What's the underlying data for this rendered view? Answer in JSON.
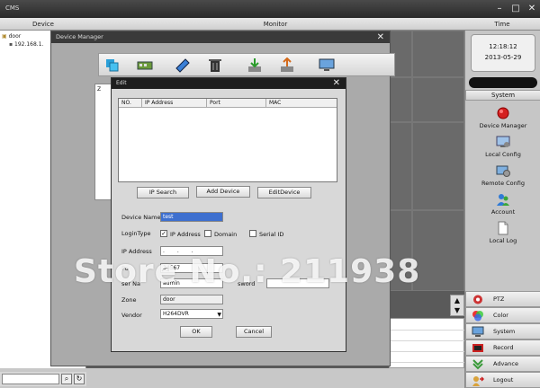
{
  "window": {
    "title": "CMS"
  },
  "columns": {
    "device": "Device",
    "monitor": "Monitor",
    "time": "Time"
  },
  "tree": {
    "root": "door",
    "child": "192.168.1."
  },
  "clock": {
    "time": "12:18:12",
    "date": "2013-05-29"
  },
  "system": {
    "header": "System",
    "items": [
      {
        "label": "Device Manager",
        "icon": "record-red-icon"
      },
      {
        "label": "Local Config",
        "icon": "local-config-icon"
      },
      {
        "label": "Remote Config",
        "icon": "remote-config-icon"
      },
      {
        "label": "Account",
        "icon": "account-icon"
      },
      {
        "label": "Local Log",
        "icon": "log-file-icon"
      }
    ]
  },
  "nav": [
    {
      "label": "PTZ",
      "icon": "ptz-icon"
    },
    {
      "label": "Color",
      "icon": "color-icon"
    },
    {
      "label": "System",
      "icon": "system-icon"
    },
    {
      "label": "Record",
      "icon": "record-icon"
    },
    {
      "label": "Advance",
      "icon": "advance-icon"
    },
    {
      "label": "Logout",
      "icon": "logout-icon"
    }
  ],
  "device_manager": {
    "title": "Device Manager",
    "list_preview": "Z"
  },
  "edit": {
    "title": "Edit",
    "table_headers": [
      "NO.",
      "IP Address",
      "Port",
      "MAC"
    ],
    "buttons": {
      "ip_search": "IP Search",
      "add_device": "Add Device",
      "edit_device": "EditDevice"
    },
    "labels": {
      "device_name": "Device Name",
      "login_type": "LoginType",
      "ip_address": "IP Address",
      "port": "Po",
      "user_name": "ser Na",
      "password": "sword",
      "zone": "Zone",
      "vendor": "Vendor"
    },
    "values": {
      "device_name": "test",
      "ip_address": ". . .",
      "port": "34567",
      "user_name": "admin",
      "zone": "door",
      "vendor": "H264DVR"
    },
    "login_options": [
      {
        "label": "IP Address",
        "checked": true
      },
      {
        "label": "Domain",
        "checked": false
      },
      {
        "label": "Serial ID",
        "checked": false
      }
    ],
    "ok": "OK",
    "cancel": "Cancel"
  },
  "watermark": "Store No.: 211938"
}
